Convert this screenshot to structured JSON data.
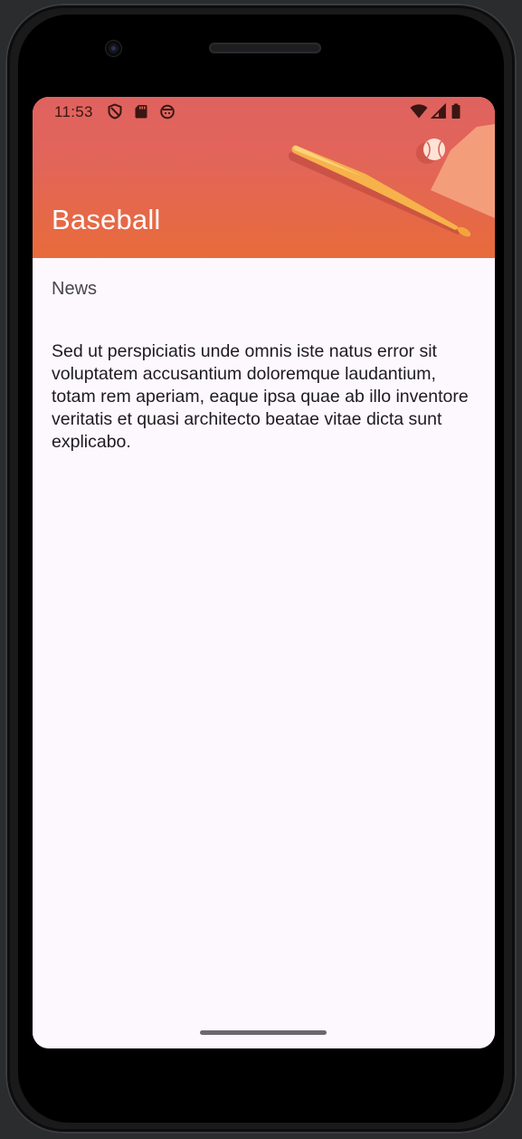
{
  "status_bar": {
    "time": "11:53",
    "left_icons": [
      "shield-icon",
      "sd-card-icon",
      "app-notification-icon"
    ],
    "right_icons": [
      "wifi-icon",
      "cellular-signal-icon",
      "battery-icon"
    ]
  },
  "app_bar": {
    "title": "Baseball",
    "illustration": "baseball-bat-and-ball-illustration"
  },
  "content": {
    "section_label": "News",
    "body": "Sed ut perspiciatis unde omnis iste natus error sit voluptatem accusantium doloremque laudantium, totam rem aperiam, eaque ipsa quae ab illo inventore veritatis et quasi architecto beatae vitae dicta sunt explicabo."
  },
  "colors": {
    "app_bar_top": "#e0625f",
    "app_bar_bottom": "#e86b3b",
    "background": "#fdf7fe",
    "title_text": "#ffffff",
    "body_text": "#1d1b20"
  }
}
